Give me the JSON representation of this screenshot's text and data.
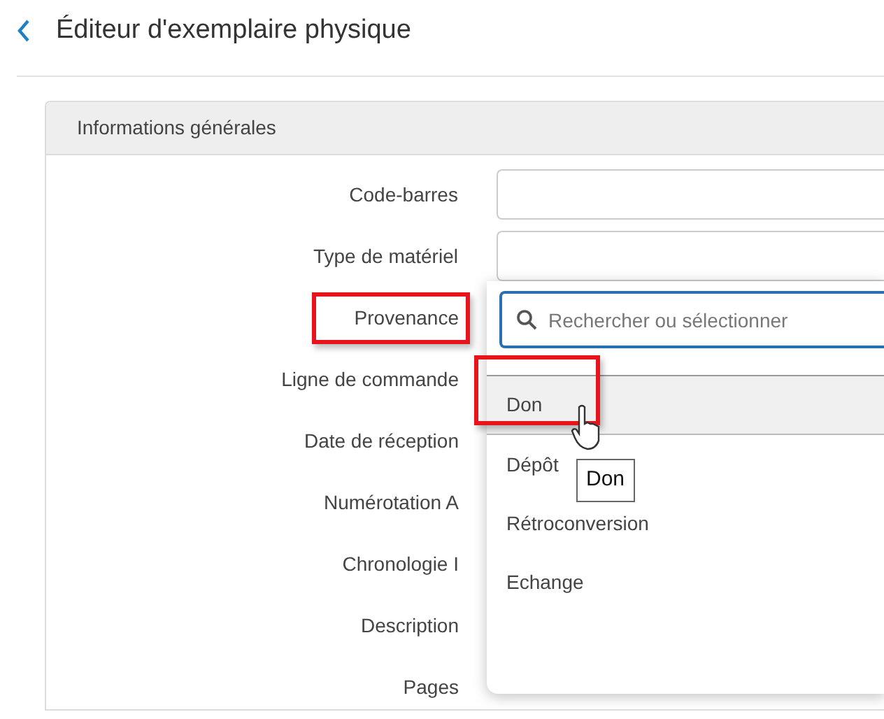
{
  "header": {
    "title": "Éditeur d'exemplaire physique"
  },
  "section": {
    "title": "Informations générales"
  },
  "fields": [
    {
      "label": "Code-barres",
      "kind": "input",
      "highlighted": false
    },
    {
      "label": "Type de matériel",
      "kind": "input",
      "highlighted": false
    },
    {
      "label": "Provenance",
      "kind": "search",
      "placeholder": "Rechercher ou sélectionner",
      "highlighted": true
    },
    {
      "label": "Ligne de commande",
      "kind": "hidden",
      "highlighted": false
    },
    {
      "label": "Date de réception",
      "kind": "hidden",
      "highlighted": false
    },
    {
      "label": "Numérotation A",
      "kind": "hidden",
      "highlighted": false
    },
    {
      "label": "Chronologie I",
      "kind": "hidden",
      "highlighted": false
    },
    {
      "label": "Description",
      "kind": "hidden",
      "highlighted": false
    },
    {
      "label": "Pages",
      "kind": "hidden",
      "highlighted": false
    }
  ],
  "dropdown": {
    "options": [
      {
        "label": "Don",
        "selected": true,
        "highlighted": true
      },
      {
        "label": "Dépôt",
        "selected": false,
        "highlighted": false
      },
      {
        "label": "Rétroconversion",
        "selected": false,
        "highlighted": false
      },
      {
        "label": "Echange",
        "selected": false,
        "highlighted": false
      }
    ],
    "tooltip": "Don"
  }
}
